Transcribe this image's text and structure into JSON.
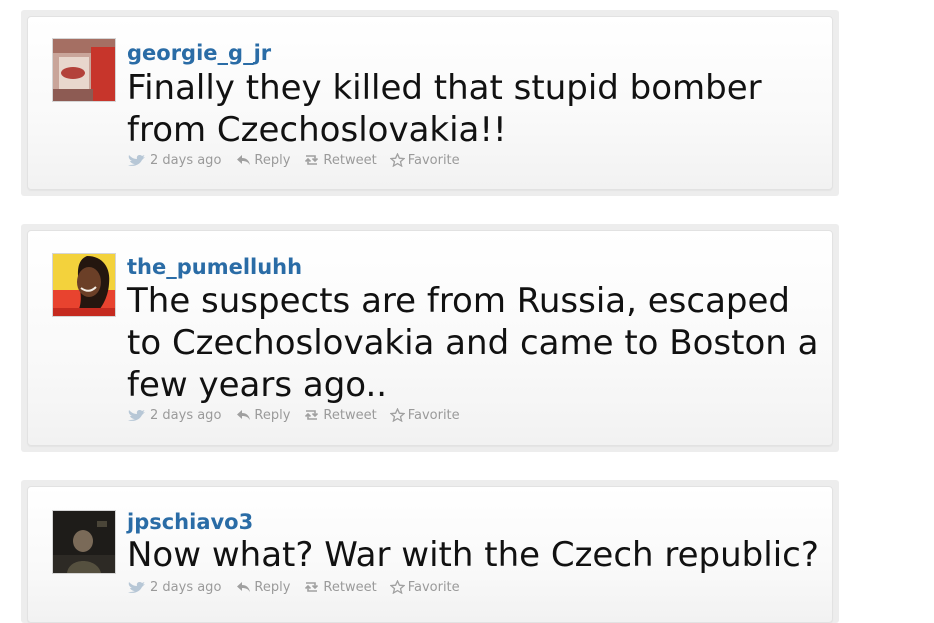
{
  "tweets": [
    {
      "username": "georgie_g_jr",
      "text": "Finally they killed that stupid bomber from Czechoslovakia!!",
      "timestamp": "2 days ago",
      "actions": {
        "reply": "Reply",
        "retweet": "Retweet",
        "favorite": "Favorite"
      }
    },
    {
      "username": "the_pumelluhh",
      "text": "The suspects are from Russia, escaped to Czechoslovakia and came to Boston a few years ago..",
      "timestamp": "2 days ago",
      "actions": {
        "reply": "Reply",
        "retweet": "Retweet",
        "favorite": "Favorite"
      }
    },
    {
      "username": "jpschiavo3",
      "text": "Now what? War with the Czech republic?",
      "timestamp": "2 days ago",
      "actions": {
        "reply": "Reply",
        "retweet": "Retweet",
        "favorite": "Favorite"
      }
    }
  ],
  "colors": {
    "username": "#2a6ca6",
    "text": "#111111",
    "meta": "#9a9a9a",
    "panel": "#ededed"
  },
  "icons": [
    "bird-icon",
    "reply-icon",
    "retweet-icon",
    "star-icon"
  ]
}
